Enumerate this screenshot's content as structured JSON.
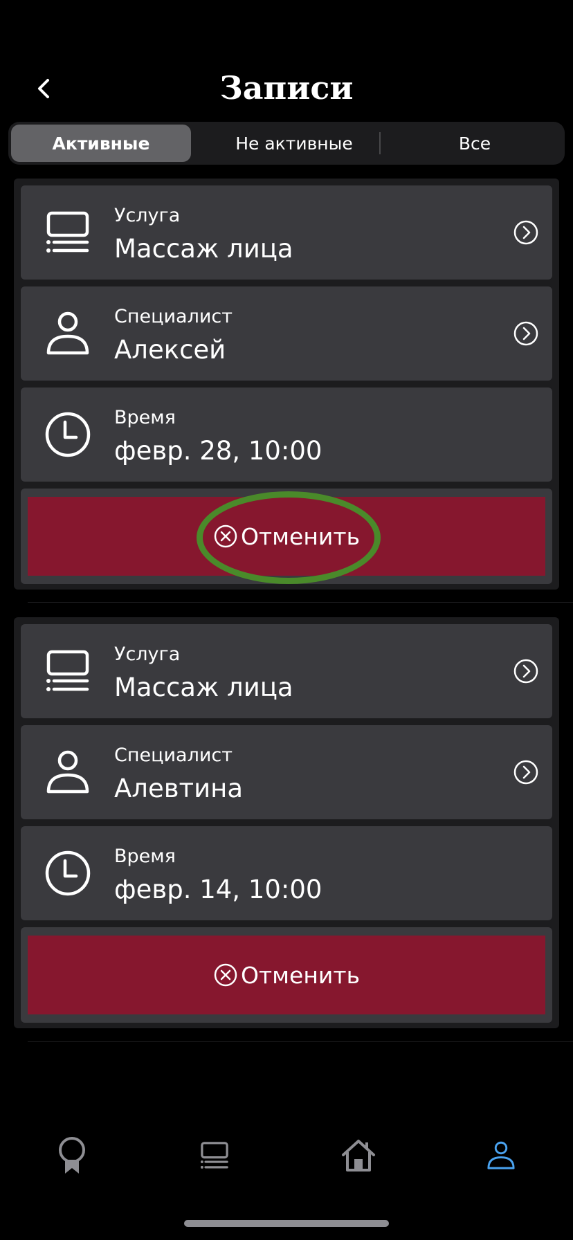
{
  "header": {
    "title": "Записи",
    "back_icon": "chevron-left-icon"
  },
  "tabs": [
    {
      "label": "Активные",
      "active": true
    },
    {
      "label": "Не активные",
      "active": false
    },
    {
      "label": "Все",
      "active": false
    }
  ],
  "appointments": [
    {
      "service_label": "Услуга",
      "service_value": "Массаж лица",
      "specialist_label": "Специалист",
      "specialist_value": "Алексей",
      "time_label": "Время",
      "time_value": "февр. 28, 10:00",
      "cancel_label": "Отменить"
    },
    {
      "service_label": "Услуга",
      "service_value": "Массаж лица",
      "specialist_label": "Специалист",
      "specialist_value": "Алевтина",
      "time_label": "Время",
      "time_value": "февр. 14, 10:00",
      "cancel_label": "Отменить"
    }
  ],
  "tabbar": {
    "items": [
      {
        "icon": "award-icon",
        "active": false
      },
      {
        "icon": "services-list-icon",
        "active": false
      },
      {
        "icon": "home-icon",
        "active": false
      },
      {
        "icon": "profile-icon",
        "active": true
      }
    ]
  },
  "colors": {
    "background": "#000000",
    "card": "#3a3a3e",
    "cancel": "#86172e",
    "accent": "#4aa3f0",
    "highlight": "#4a8a2a"
  }
}
